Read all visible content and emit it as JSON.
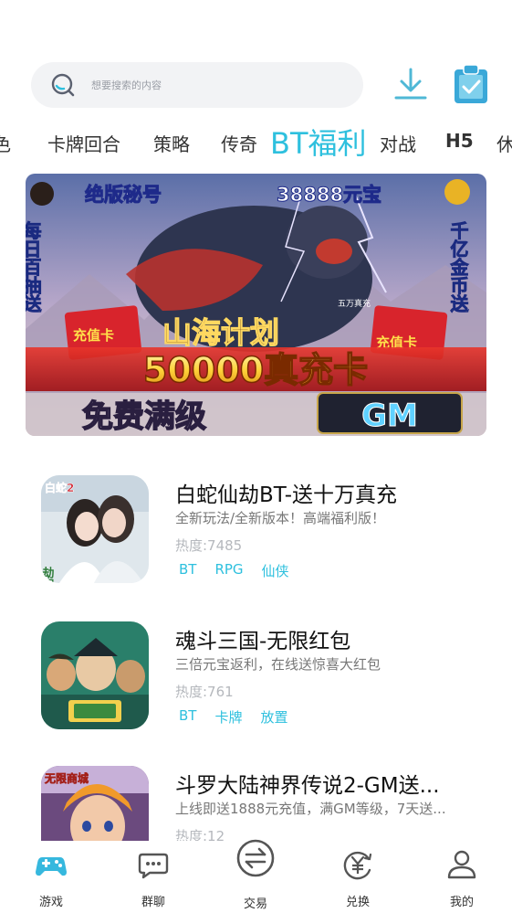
{
  "search": {
    "placeholder": "想要搜索的内容"
  },
  "tabs": [
    {
      "label": "色"
    },
    {
      "label": "卡牌回合"
    },
    {
      "label": "策略"
    },
    {
      "label": "传奇"
    },
    {
      "label": "BT福利"
    },
    {
      "label": "对战"
    },
    {
      "label": "H5"
    },
    {
      "label": "休"
    }
  ],
  "banner": {
    "top_left": "绝版秘号",
    "top_right": "38888元宝",
    "left_side": "每日百抽送",
    "right_side": "千亿金币送",
    "logo": "山海计划",
    "logo_badge": "五万真充",
    "card_left": "充值卡",
    "card_right": "充值卡",
    "headline": "50000真充卡",
    "subline": "免费满级",
    "gm": "GM",
    "thumb_text": "白蛇2"
  },
  "games": [
    {
      "title": "白蛇仙劫BT-送十万真充",
      "desc": "全新玩法/全新版本！高端福利版！",
      "heat": "热度:7485",
      "tags": [
        "BT",
        "RPG",
        "仙侠"
      ],
      "thumb_label": "白蛇2",
      "thumb_badge": "劫起"
    },
    {
      "title": "魂斗三国-无限红包",
      "desc": "三倍元宝返利，在线送惊喜大红包",
      "heat": "热度:761",
      "tags": [
        "BT",
        "卡牌",
        "放置"
      ]
    },
    {
      "title": "斗罗大陆神界传说2-GM送...",
      "desc": "上线即送1888元充值，满GM等级，7天送...",
      "heat": "热度:12",
      "tags": [],
      "thumb_label": "无限商城"
    }
  ],
  "nav": [
    {
      "label": "游戏",
      "icon": "gamepad-icon",
      "active": true
    },
    {
      "label": "群聊",
      "icon": "chat-icon"
    },
    {
      "label": "交易",
      "icon": "trade-icon"
    },
    {
      "label": "兑换",
      "icon": "exchange-yuan-icon"
    },
    {
      "label": "我的",
      "icon": "user-icon"
    }
  ],
  "colors": {
    "accent": "#2ec0de",
    "muted": "#b5b8bd"
  }
}
